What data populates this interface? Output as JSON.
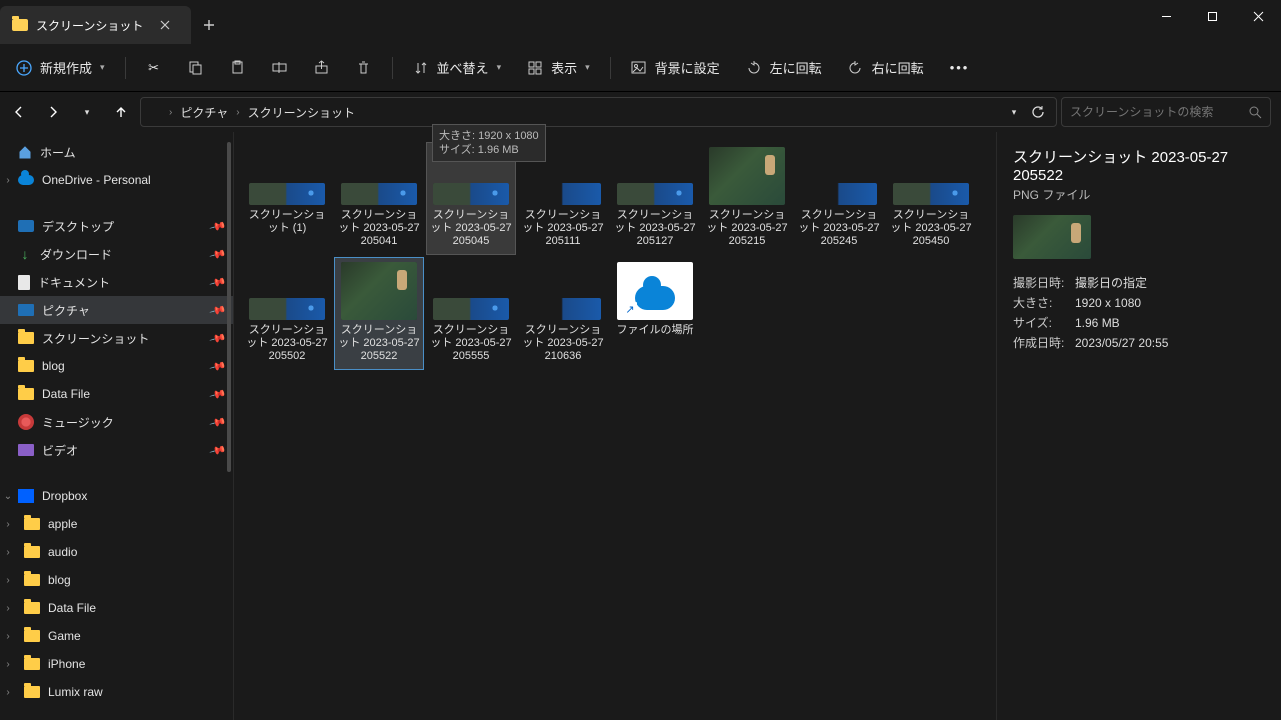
{
  "tab": {
    "title": "スクリーンショット"
  },
  "toolbar": {
    "new": "新規作成",
    "sort": "並べ替え",
    "view": "表示",
    "set_bg": "背景に設定",
    "rotate_left": "左に回転",
    "rotate_right": "右に回転"
  },
  "breadcrumb": {
    "parts": [
      "ピクチャ",
      "スクリーンショット"
    ]
  },
  "search": {
    "placeholder": "スクリーンショットの検索"
  },
  "sidebar": {
    "home": "ホーム",
    "onedrive": "OneDrive - Personal",
    "pinned": [
      {
        "label": "デスクトップ",
        "icon": "desktop"
      },
      {
        "label": "ダウンロード",
        "icon": "download"
      },
      {
        "label": "ドキュメント",
        "icon": "doc"
      },
      {
        "label": "ピクチャ",
        "icon": "pic",
        "sel": true
      },
      {
        "label": "スクリーンショット",
        "icon": "folder"
      },
      {
        "label": "blog",
        "icon": "folder"
      },
      {
        "label": "Data File",
        "icon": "folder"
      },
      {
        "label": "ミュージック",
        "icon": "music"
      },
      {
        "label": "ビデオ",
        "icon": "video"
      }
    ],
    "dropbox": "Dropbox",
    "dropbox_children": [
      "apple",
      "audio",
      "blog",
      "Data File",
      "Game",
      "iPhone",
      "Lumix raw"
    ]
  },
  "files": [
    {
      "name": "スクリーンショット (1)",
      "thumb": "game-small"
    },
    {
      "name": "スクリーンショット 2023-05-27 205041",
      "thumb": "game-small"
    },
    {
      "name": "スクリーンショット 2023-05-27 205045",
      "thumb": "game-small",
      "hover": true
    },
    {
      "name": "スクリーンショット 2023-05-27 205111",
      "thumb": "dark-small"
    },
    {
      "name": "スクリーンショット 2023-05-27 205127",
      "thumb": "game-small"
    },
    {
      "name": "スクリーンショット 2023-05-27 205215",
      "thumb": "game-big"
    },
    {
      "name": "スクリーンショット 2023-05-27 205245",
      "thumb": "dark-small"
    },
    {
      "name": "スクリーンショット 2023-05-27 205450",
      "thumb": "game-small"
    },
    {
      "name": "スクリーンショット 2023-05-27 205502",
      "thumb": "game-small"
    },
    {
      "name": "スクリーンショット 2023-05-27 205522",
      "thumb": "game-big",
      "sel": true
    },
    {
      "name": "スクリーンショット 2023-05-27 205555",
      "thumb": "game-small"
    },
    {
      "name": "スクリーンショット 2023-05-27 210636",
      "thumb": "dark-small"
    },
    {
      "name": "ファイルの場所",
      "thumb": "cloud",
      "shortcut": true
    }
  ],
  "tooltip": {
    "line1": "大きさ: 1920 x 1080",
    "line2": "サイズ: 1.96 MB"
  },
  "details": {
    "title": "スクリーンショット 2023-05-27 205522",
    "subtitle": "PNG ファイル",
    "rows": [
      {
        "label": "撮影日時:",
        "value": "撮影日の指定"
      },
      {
        "label": "大きさ:",
        "value": "1920 x 1080"
      },
      {
        "label": "サイズ:",
        "value": "1.96 MB"
      },
      {
        "label": "作成日時:",
        "value": "2023/05/27 20:55"
      }
    ]
  }
}
